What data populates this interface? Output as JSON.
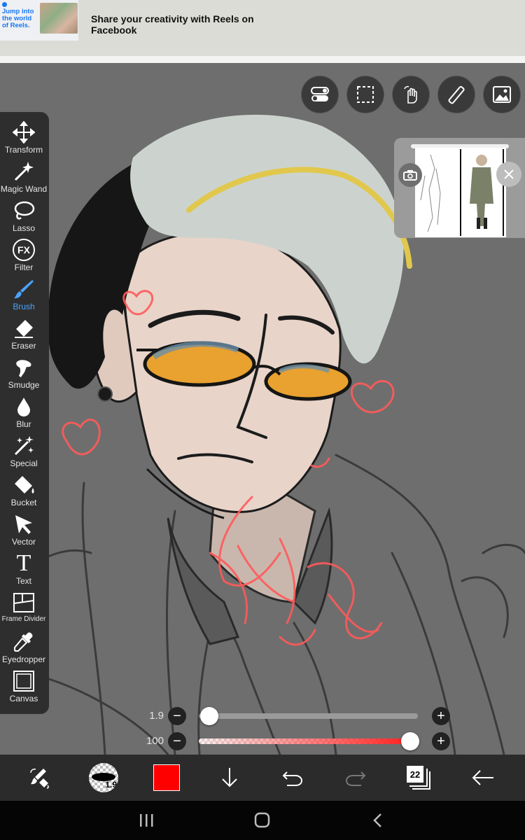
{
  "ad": {
    "thumb_text": "Jump into the world of Reels.",
    "headline": "Share your creativity with Reels on Facebook"
  },
  "toolbar": {
    "items": [
      {
        "label": "Transform",
        "icon": "move-arrows-icon"
      },
      {
        "label": "Magic Wand",
        "icon": "magic-wand-icon"
      },
      {
        "label": "Lasso",
        "icon": "lasso-icon"
      },
      {
        "label": "Filter",
        "icon": "fx-icon",
        "glyph": "FX"
      },
      {
        "label": "Brush",
        "icon": "brush-icon",
        "active": true
      },
      {
        "label": "Eraser",
        "icon": "eraser-icon"
      },
      {
        "label": "Smudge",
        "icon": "smudge-icon"
      },
      {
        "label": "Blur",
        "icon": "droplet-icon"
      },
      {
        "label": "Special",
        "icon": "special-brush-icon"
      },
      {
        "label": "Bucket",
        "icon": "bucket-icon"
      },
      {
        "label": "Vector",
        "icon": "cursor-arrow-icon"
      },
      {
        "label": "Text",
        "icon": "text-t-icon",
        "glyph": "T"
      },
      {
        "label": "Frame Divider",
        "icon": "frame-divider-icon"
      },
      {
        "label": "Eyedropper",
        "icon": "eyedropper-icon"
      },
      {
        "label": "Canvas",
        "icon": "canvas-square-icon"
      }
    ]
  },
  "top_tools": [
    "toggle-icon",
    "selection-dashed-icon",
    "hand-gesture-icon",
    "ruler-icon",
    "image-reference-icon"
  ],
  "sliders": {
    "size": {
      "value": "1.9",
      "fraction": 0.0
    },
    "opacity": {
      "value": "100",
      "fraction": 1.0
    },
    "minus_glyph": "−",
    "plus_glyph": "+"
  },
  "bottom_bar": {
    "brush_size": "1.9",
    "color": "#ff0000",
    "layer_count": "22"
  },
  "colors": {
    "accent": "#4aa3ff",
    "toolbar_bg": "#2e2e2e",
    "canvas_bg": "#6e6e6e",
    "primary_color": "#ff0000"
  }
}
